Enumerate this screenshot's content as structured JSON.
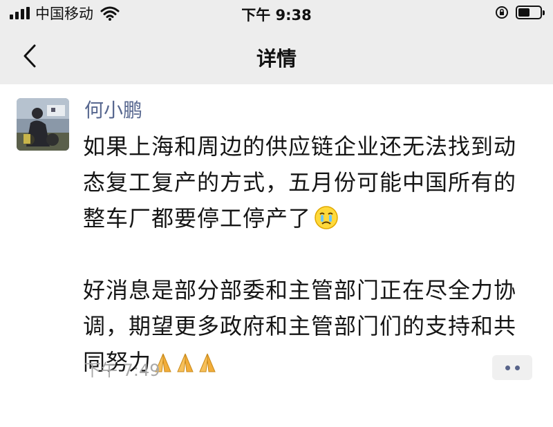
{
  "status_bar": {
    "carrier": "中国移动",
    "time": "下午 9:38",
    "icons": [
      "signal-icon",
      "wifi-icon",
      "rotation-lock-icon",
      "battery-icon"
    ]
  },
  "nav": {
    "title": "详情",
    "back_icon": "chevron-left-icon"
  },
  "post": {
    "author": "何小鹏",
    "paragraph_1": "如果上海和周边的供应链企业还无法找到动态复工复产的方式，五月份可能中国所有的整车厂都要停工停产了",
    "paragraph_1_emoji": "crying-face-emoji",
    "paragraph_2": "好消息是部分部委和主管部门正在尽全力协调，期望更多政府和主管部门们的支持和共同努力",
    "paragraph_2_emoji": [
      "pray-emoji",
      "pray-emoji",
      "pray-emoji"
    ],
    "time": "下午 7:49",
    "more_icon": "more-dots-icon"
  },
  "colors": {
    "header_bg": "#ededed",
    "author_name": "#57678f",
    "timestamp": "#a9a9a9"
  }
}
